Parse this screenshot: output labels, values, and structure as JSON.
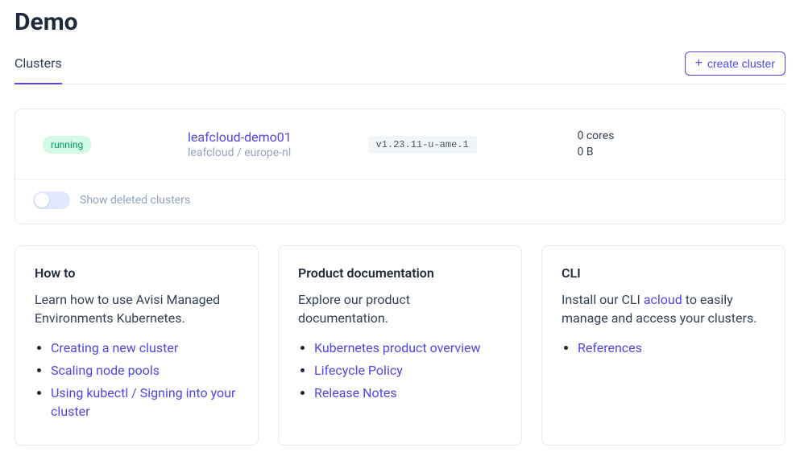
{
  "header": {
    "title": "Demo",
    "tab_label": "Clusters",
    "create_label": "create cluster"
  },
  "cluster": {
    "status": "running",
    "name": "leafcloud-demo01",
    "location": "leafcloud / europe-nl",
    "version": "v1.23.11-u-ame.1",
    "cores": "0 cores",
    "storage": "0 B"
  },
  "show_deleted": {
    "label": "Show deleted clusters",
    "enabled": false
  },
  "cards": {
    "howto": {
      "title": "How to",
      "text": "Learn how to use Avisi Managed Environments Kubernetes.",
      "links": [
        "Creating a new cluster",
        "Scaling node pools",
        "Using kubectl / Signing into your cluster"
      ]
    },
    "docs": {
      "title": "Product documentation",
      "text": "Explore our product documentation.",
      "links": [
        "Kubernetes product overview",
        "Lifecycle Policy",
        "Release Notes"
      ]
    },
    "cli": {
      "title": "CLI",
      "text_pre": "Install our CLI ",
      "text_link": "acloud",
      "text_post": " to easily manage and access your clusters.",
      "links": [
        "References"
      ]
    }
  }
}
